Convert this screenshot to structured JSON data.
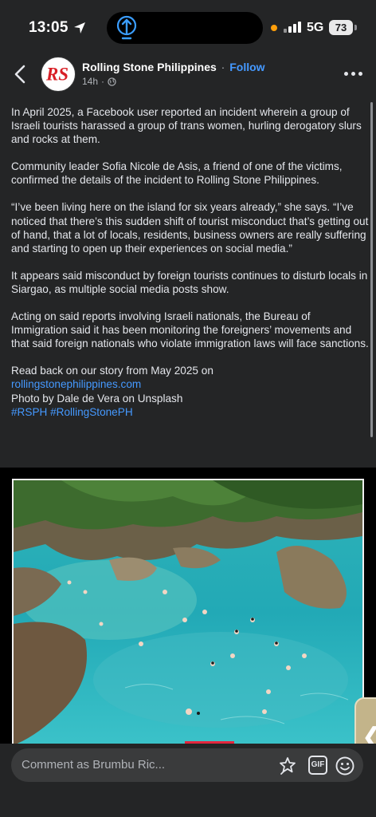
{
  "status_bar": {
    "time": "13:05",
    "network": "5G",
    "battery": "73",
    "accent_color": "#ff9f0a"
  },
  "post": {
    "page_name": "Rolling Stone Philippines",
    "separator": "·",
    "follow_label": "Follow",
    "timestamp": "14h",
    "privacy_separator": "·",
    "avatar_text": "RS",
    "avatar_color": "#d81f26",
    "paragraphs": [
      "In April 2025, a Facebook user reported an incident wherein a group of Israeli tourists harassed a group of trans women, hurling derogatory slurs and rocks at them.",
      "Community leader Sofia Nicole de Asis, a friend of one of the victims, confirmed the details of the incident to Rolling Stone Philippines.",
      "“I’ve been living here on the island for six years already,” she says. “I’ve noticed that there’s this sudden shift of tourist misconduct that’s getting out of hand, that a lot of locals, residents, business owners are really suffering and starting to open up their experiences on social media.”",
      "It appears said misconduct by foreign tourists continues to disturb locals in Siargao, as multiple social media posts show.",
      "Acting on said reports involving Israeli nationals, the Bureau of Immigration said it has been monitoring the foreigners’ movements and that said foreign nationals who violate immigration laws will face sanctions."
    ],
    "read_back": "Read back on our story from May 2025 on",
    "link": "rollingstonephilippines.com",
    "photo_credit": "Photo by Dale de Vera on Unsplash",
    "hashtags": "#RSPH #RollingStonePH",
    "link_color": "#4599ff"
  },
  "comment_bar": {
    "placeholder": "Comment as Brumbu Ric...",
    "gif_label": "GIF",
    "side_tab_glyph": "❮"
  },
  "icons": [
    "back-arrow-icon",
    "location-arrow-icon",
    "airdrop-icon",
    "globe-icon",
    "more-options-icon",
    "sticker-icon",
    "gif-icon",
    "emoji-icon"
  ]
}
